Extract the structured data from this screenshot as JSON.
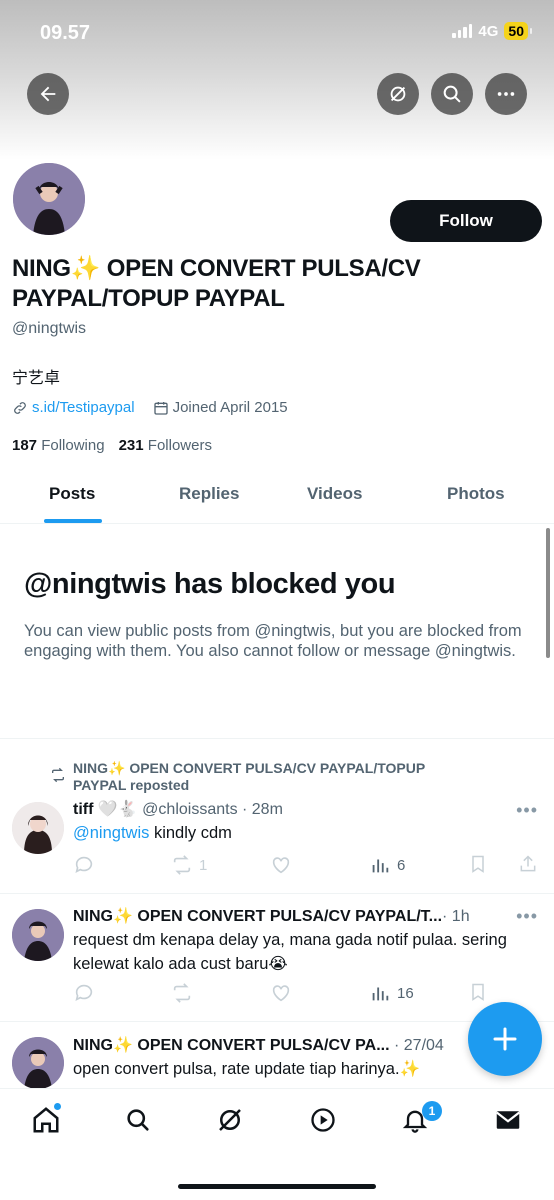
{
  "status_bar": {
    "time": "09.57",
    "network": "4G",
    "battery": "50"
  },
  "header": {
    "back_icon": "arrow-left-icon",
    "grok_icon": "grok-icon",
    "search_icon": "search-icon",
    "more_icon": "more-horizontal-icon"
  },
  "profile": {
    "follow_label": "Follow",
    "display_name": "NING✨ OPEN CONVERT PULSA/CV PAYPAL/TOPUP PAYPAL",
    "handle": "@ningtwis",
    "bio": "宁艺卓",
    "link": "s.id/Testipaypal",
    "joined": "Joined April 2015",
    "following_count": "187",
    "following_label": "Following",
    "followers_count": "231",
    "followers_label": "Followers"
  },
  "tabs": [
    {
      "label": "Posts"
    },
    {
      "label": "Replies"
    },
    {
      "label": "Videos"
    },
    {
      "label": "Photos"
    }
  ],
  "blocked": {
    "title": "@ningtwis has blocked you",
    "text": "You can view public posts from @ningtwis, but you are blocked from engaging with them. You also cannot follow or message @ningtwis."
  },
  "posts": [
    {
      "repost_label": "NING✨ OPEN CONVERT PULSA/CV PAYPAL/TOPUP PAYPAL reposted",
      "name": "tiff 🤍🐇",
      "handle": "@chloissants · 28m",
      "mention": "@ningtwis",
      "text": " kindly cdm",
      "reposts": "1",
      "views": "6"
    },
    {
      "name": "NING✨ OPEN CONVERT PULSA/CV PAYPAL/T...",
      "handle": "· 1h",
      "text": "request dm kenapa delay ya, mana gada notif pulaa. sering kelewat kalo ada cust baru😭",
      "views": "16"
    },
    {
      "name": "NING✨ OPEN CONVERT PULSA/CV PA...",
      "handle": "· 27/04",
      "text": "open convert pulsa, rate update tiap harinya.✨"
    }
  ],
  "nav": {
    "notifications_badge": "1"
  },
  "colors": {
    "accent": "#1d9bf0",
    "text": "#0f1419",
    "secondary": "#536471"
  }
}
